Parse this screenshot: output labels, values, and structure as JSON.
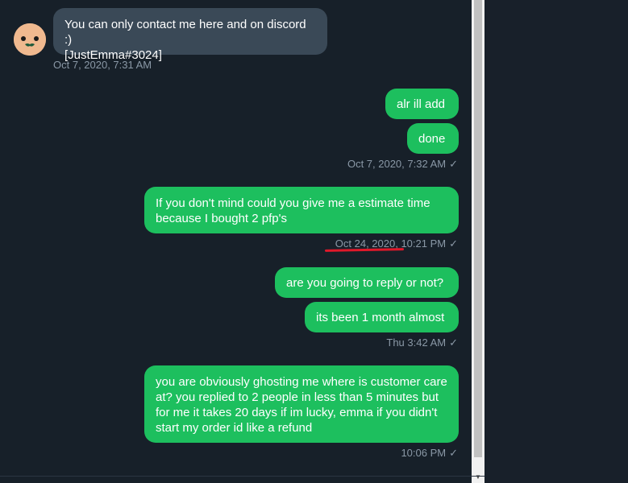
{
  "messages": {
    "m1": {
      "text_line1": "You can only contact me here and on discord :)",
      "text_line2": "[JustEmma#3024]",
      "time": "Oct 7, 2020, 7:31 AM"
    },
    "m2": {
      "text": "alr ill add"
    },
    "m3": {
      "text": "done",
      "time": "Oct 7, 2020, 7:32 AM"
    },
    "m4": {
      "text_line1": "If you don't mind could you give me a estimate time",
      "text_line2": "because I bought 2 pfp's",
      "time": "Oct 24, 2020, 10:21 PM"
    },
    "m5": {
      "text": "are you going to reply or not?"
    },
    "m6": {
      "text": "its been 1 month almost",
      "time": "Thu 3:42 AM"
    },
    "m7": {
      "line1": "you are obviously ghosting me where is customer care",
      "line2": "at? you replied to 2 people in less than 5 minutes but",
      "line3": "for me it takes 20 days if im lucky, emma if you didn't",
      "line4": "start my order id like a refund",
      "time": "10:06 PM"
    }
  },
  "check_mark": "✓",
  "scroll_down_arrow": "▼",
  "colors": {
    "outgoing": "#1dbf5e",
    "incoming": "#3a4957",
    "background": "#172029",
    "annotation": "#e0182a"
  },
  "icons": {
    "avatar": "avatar-face-icon",
    "read_receipt": "check-icon"
  }
}
